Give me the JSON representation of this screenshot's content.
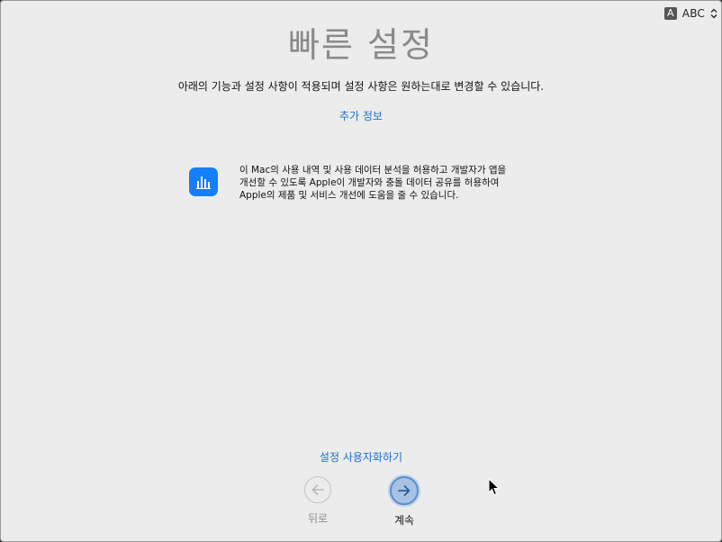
{
  "input_menu": {
    "badge": "A",
    "name": "ABC"
  },
  "title": "빠른 설정",
  "subtitle": "아래의 기능과 설정 사항이 적용되며 설정 사항은 원하는대로 변경할 수 있습니다.",
  "more_info_link": "추가 정보",
  "analytics": {
    "icon": "bar-chart-icon",
    "text": "이 Mac의 사용 내역 및 사용 데이터 분석을 허용하고 개발자가 앱을\n개선할 수 있도록 Apple이 개발자와 충돌 데이터 공유를 허용하여\nApple의 제품 및 서비스 개선에 도움을 줄 수 있습니다."
  },
  "customize_link": "설정 사용자화하기",
  "nav": {
    "back_label": "뒤로",
    "next_label": "계속"
  },
  "colors": {
    "link": "#1d6ed1",
    "icon_bg": "#157efb",
    "title": "#8a8a8a",
    "next_fill": "#a8c3e3"
  }
}
